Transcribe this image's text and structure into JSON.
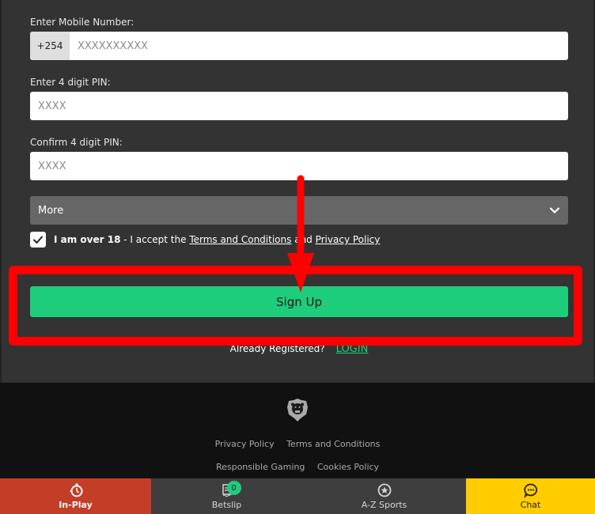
{
  "form": {
    "mobile_label": "Enter Mobile Number:",
    "country_code": "+254",
    "mobile_placeholder": "XXXXXXXXXX",
    "mobile_value": "",
    "pin_label": "Enter 4 digit PIN:",
    "pin_placeholder": "XXXX",
    "pin_value": "",
    "confirm_pin_label": "Confirm 4 digit PIN:",
    "confirm_pin_placeholder": "XXXX",
    "confirm_pin_value": "",
    "more_label": "More",
    "agree_checked": true,
    "agree_bold": "I am over 18",
    "agree_text": " - I accept the ",
    "terms_link": "Terms and Conditions",
    "and_text": " and ",
    "privacy_link": "Privacy Policy",
    "signup_label": "Sign Up",
    "already_registered": "Already Registered?",
    "login_link": "LOGIN"
  },
  "annotation": {
    "color": "#ff0000",
    "target": "Sign Up"
  },
  "footer": {
    "logo_icon": "bear-shield-logo",
    "links_row1": [
      "Privacy Policy",
      "Terms and Conditions"
    ],
    "links_row2": [
      "Responsible Gaming",
      "Cookies Policy"
    ]
  },
  "bottom_nav": {
    "items": [
      {
        "label": "In-Play",
        "icon": "stopwatch-icon",
        "color": "#c43d26"
      },
      {
        "label": "Betslip",
        "icon": "receipt-icon",
        "badge": "0",
        "color": "#3e3e3e"
      },
      {
        "label": "A-Z Sports",
        "icon": "star-circle-icon",
        "color": "#3e3e3e"
      },
      {
        "label": "Chat",
        "icon": "chat-bubble-icon",
        "color": "#ffcc00"
      }
    ]
  },
  "colors": {
    "accent_green": "#1ecd7b",
    "background": "#333333",
    "footer_bg": "#111111"
  }
}
